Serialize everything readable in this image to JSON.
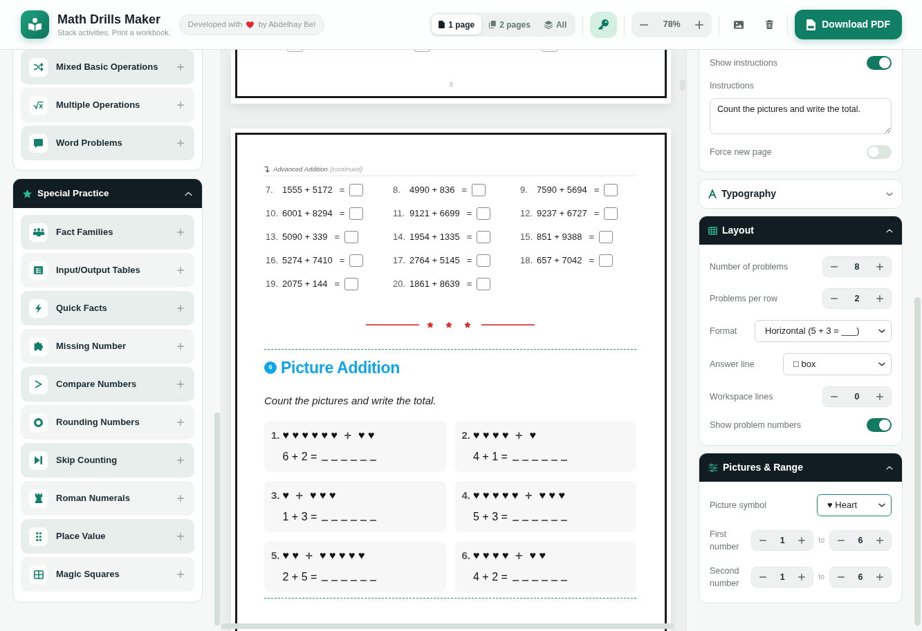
{
  "header": {
    "title": "Math Drills Maker",
    "subtitle": "Stack activities. Print a workbook.",
    "credit": {
      "before": "Developed with",
      "after": "by Abdelhay Bel"
    },
    "view_tabs": [
      {
        "label": "1 page",
        "selected": true
      },
      {
        "label": "2 pages",
        "selected": false
      },
      {
        "label": "All",
        "selected": false
      }
    ],
    "zoom": {
      "value": "78%"
    },
    "download_button": {
      "label": "Download PDF"
    }
  },
  "sidebar": {
    "groups": [
      {
        "items": [
          {
            "label": "Mixed Basic Operations"
          },
          {
            "label": "Multiple Operations"
          },
          {
            "label": "Word Problems"
          }
        ]
      },
      {
        "title": "Special Practice",
        "expanded": true,
        "items": [
          {
            "label": "Fact Families"
          },
          {
            "label": "Input/Output Tables"
          },
          {
            "label": "Quick Facts"
          },
          {
            "label": "Missing Number"
          },
          {
            "label": "Compare Numbers"
          },
          {
            "label": "Rounding Numbers"
          },
          {
            "label": "Skip Counting"
          },
          {
            "label": "Roman Numerals"
          },
          {
            "label": "Place Value"
          },
          {
            "label": "Magic Squares"
          }
        ]
      }
    ]
  },
  "preview": {
    "pages": [
      {
        "problems": [
          {
            "kind": "box"
          },
          {
            "kind": "box"
          },
          {
            "kind": "box"
          }
        ],
        "page_number": "3"
      },
      {
        "continued": {
          "title": "Advanced Addition",
          "note": "(continued)"
        },
        "problems": [
          {
            "number": "7.",
            "expression": "1555 + 5172",
            "equals": "="
          },
          {
            "number": "8.",
            "expression": "4990 + 836",
            "equals": "="
          },
          {
            "number": "9.",
            "expression": "7590 + 5694",
            "equals": "="
          },
          {
            "number": "10.",
            "expression": "6001 + 8294",
            "equals": "="
          },
          {
            "number": "11.",
            "expression": "9121 + 6699",
            "equals": "="
          },
          {
            "number": "12.",
            "expression": "9237 + 6727",
            "equals": "="
          },
          {
            "number": "13.",
            "expression": "5090 + 339",
            "equals": "="
          },
          {
            "number": "14.",
            "expression": "1954 + 1335",
            "equals": "="
          },
          {
            "number": "15.",
            "expression": "851 + 9388",
            "equals": "="
          },
          {
            "number": "16.",
            "expression": "5274 + 7410",
            "equals": "="
          },
          {
            "number": "17.",
            "expression": "2764 + 5145",
            "equals": "="
          },
          {
            "number": "18.",
            "expression": "657 + 7042",
            "equals": "="
          },
          {
            "number": "19.",
            "expression": "2075 + 144",
            "equals": "="
          },
          {
            "number": "20.",
            "expression": "1861 + 8639",
            "equals": "="
          }
        ],
        "section": {
          "number": "6",
          "title": "Picture Addition",
          "instructions": "Count the pictures and write the total.",
          "problems": [
            {
              "number": "1.",
              "first": "♥♥♥♥♥♥",
              "operator": "+",
              "second": "♥♥",
              "equation": "6 + 2 ="
            },
            {
              "number": "2.",
              "first": "♥♥♥♥",
              "operator": "+",
              "second": "♥",
              "equation": "4 + 1 ="
            },
            {
              "number": "3.",
              "first": "♥",
              "operator": "+",
              "second": "♥♥♥",
              "equation": "1 + 3 ="
            },
            {
              "number": "4.",
              "first": "♥♥♥♥♥",
              "operator": "+",
              "second": "♥♥♥",
              "equation": "5 + 3 ="
            },
            {
              "number": "5.",
              "first": "♥♥",
              "operator": "+",
              "second": "♥♥♥♥♥",
              "equation": "2 + 5 ="
            },
            {
              "number": "6.",
              "first": "♥♥♥♥",
              "operator": "+",
              "second": "♥♥",
              "equation": "4 + 2 ="
            }
          ]
        }
      }
    ]
  },
  "settings": {
    "panels": [
      {
        "rows": [
          {
            "kind": "toggle",
            "label": "Show instructions",
            "on": true
          },
          {
            "kind": "textarea",
            "label": "Instructions",
            "value": "Count the pictures and write the total."
          },
          {
            "kind": "toggle",
            "label": "Force new page",
            "on": false
          }
        ]
      },
      {
        "title": "Typography",
        "expanded": false
      },
      {
        "title": "Layout",
        "expanded": true,
        "rows": [
          {
            "kind": "stepper",
            "label": "Number of problems",
            "value": "8"
          },
          {
            "kind": "stepper",
            "label": "Problems per row",
            "value": "2"
          },
          {
            "kind": "select",
            "label": "Format",
            "value": "Horizontal (5 + 3 = ___)",
            "focused": false
          },
          {
            "kind": "select",
            "label": "Answer line",
            "value": "□ box",
            "focused": false
          },
          {
            "kind": "stepper",
            "label": "Workspace lines",
            "value": "0"
          },
          {
            "kind": "toggle",
            "label": "Show problem numbers",
            "on": true
          }
        ]
      },
      {
        "title": "Pictures & Range",
        "expanded": true,
        "rows": [
          {
            "kind": "select",
            "label": "Picture symbol",
            "value": "♥ Heart",
            "focused": true
          },
          {
            "kind": "range",
            "label": "First number",
            "from": "1",
            "separator": "to",
            "to": "6"
          },
          {
            "kind": "range",
            "label": "Second number",
            "from": "1",
            "separator": "to",
            "to": "6"
          }
        ]
      }
    ]
  }
}
